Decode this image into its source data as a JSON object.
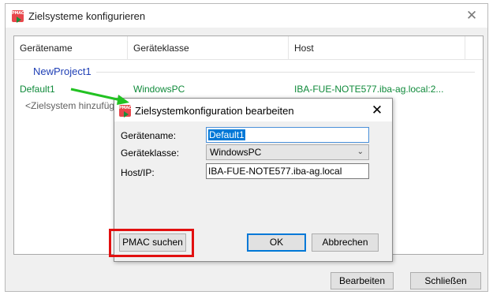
{
  "outer": {
    "icon": "pmac-app-icon",
    "icon_text": "PMAC",
    "title": "Zielsysteme konfigurieren",
    "close_glyph": "✕"
  },
  "listview": {
    "columns": [
      "Gerätename",
      "Geräteklasse",
      "Host"
    ],
    "group": "NewProject1",
    "rows": [
      {
        "name": "Default1",
        "class": "WindowsPC",
        "host": "IBA-FUE-NOTE577.iba-ag.local:2..."
      }
    ],
    "add_row": "<Zielsystem hinzufügen>"
  },
  "outer_buttons": {
    "edit": "Bearbeiten",
    "close": "Schließen"
  },
  "dialog": {
    "icon": "pmac-app-icon",
    "icon_text": "PMAC",
    "title": "Zielsystemkonfiguration bearbeiten",
    "close_glyph": "✕",
    "labels": {
      "name": "Gerätename:",
      "class": "Geräteklasse:",
      "host": "Host/IP:"
    },
    "values": {
      "name": "Default1",
      "class": "WindowsPC",
      "host": "IBA-FUE-NOTE577.iba-ag.local"
    },
    "select_icon": "chevron-down-icon",
    "buttons": {
      "pmac": "PMAC suchen",
      "ok": "OK",
      "cancel": "Abbrechen"
    }
  },
  "annotations": {
    "arrow_color": "#22c222",
    "highlight_color": "#e21010"
  },
  "colors": {
    "group_title": "#1f3fb5",
    "row_text": "#0f8a3a",
    "selection": "#0078d7",
    "icon_red": "#e8474c"
  }
}
